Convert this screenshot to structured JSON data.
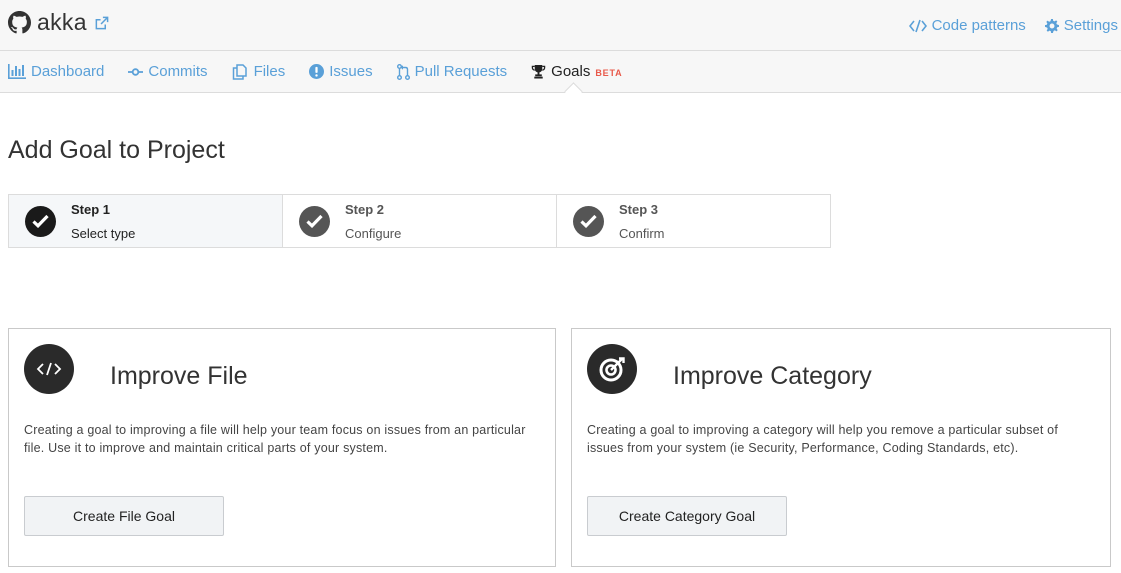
{
  "header": {
    "repo_name": "akka",
    "code_patterns_label": "Code patterns",
    "settings_label": "Settings",
    "icons": [
      "github-icon",
      "external-link-icon",
      "code-icon",
      "gear-icon"
    ]
  },
  "nav": {
    "tabs": [
      {
        "label": "Dashboard",
        "icon": "bar-chart-icon"
      },
      {
        "label": "Commits",
        "icon": "commit-icon"
      },
      {
        "label": "Files",
        "icon": "files-icon"
      },
      {
        "label": "Issues",
        "icon": "exclamation-circle-icon"
      },
      {
        "label": "Pull Requests",
        "icon": "pull-request-icon"
      },
      {
        "label": "Goals",
        "icon": "trophy-icon",
        "badge": "BETA",
        "active": true
      }
    ]
  },
  "page": {
    "title": "Add Goal to Project"
  },
  "steps": [
    {
      "title": "Step 1",
      "subtitle": "Select type",
      "active": true
    },
    {
      "title": "Step 2",
      "subtitle": "Configure",
      "active": false
    },
    {
      "title": "Step 3",
      "subtitle": "Confirm",
      "active": false
    }
  ],
  "cards": [
    {
      "title": "Improve File",
      "icon": "code-icon",
      "description": "Creating a goal to improving a file will help your team focus on issues from an particular file. Use it to improve and maintain critical parts of your system.",
      "button_label": "Create File Goal"
    },
    {
      "title": "Improve Category",
      "icon": "target-icon",
      "description": "Creating a goal to improving a category will help you remove a particular subset of issues from your system (ie Security, Performance, Coding Standards, etc).",
      "button_label": "Create Category Goal"
    }
  ],
  "colors": {
    "link": "#5aa0d8",
    "beta_badge": "#e8594a",
    "bar_background": "#f7f7f7",
    "active_step_background": "#f5f7f9"
  }
}
